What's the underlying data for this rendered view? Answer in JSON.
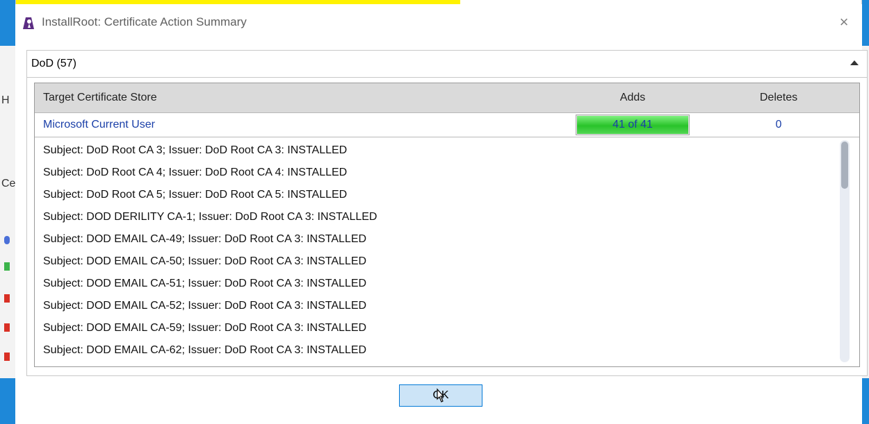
{
  "window": {
    "title": "InstallRoot: Certificate Action Summary",
    "close_glyph": "×"
  },
  "group": {
    "title": "DoD (57)"
  },
  "table": {
    "headers": {
      "store": "Target Certificate Store",
      "adds": "Adds",
      "deletes": "Deletes"
    },
    "store_row": {
      "name": "Microsoft Current User",
      "adds_text": "41 of 41",
      "adds_progress": 1.0,
      "deletes": "0"
    },
    "entries": [
      "Subject: DoD Root CA 3; Issuer: DoD Root CA 3: INSTALLED",
      "Subject: DoD Root CA 4; Issuer: DoD Root CA 4: INSTALLED",
      "Subject: DoD Root CA 5; Issuer: DoD Root CA 5: INSTALLED",
      "Subject: DOD DERILITY CA-1; Issuer: DoD Root CA 3: INSTALLED",
      "Subject: DOD EMAIL CA-49; Issuer: DoD Root CA 3: INSTALLED",
      "Subject: DOD EMAIL CA-50; Issuer: DoD Root CA 3: INSTALLED",
      "Subject: DOD EMAIL CA-51; Issuer: DoD Root CA 3: INSTALLED",
      "Subject: DOD EMAIL CA-52; Issuer: DoD Root CA 3: INSTALLED",
      "Subject: DOD EMAIL CA-59; Issuer: DoD Root CA 3: INSTALLED",
      "Subject: DOD EMAIL CA-62; Issuer: DoD Root CA 3: INSTALLED"
    ]
  },
  "footer": {
    "ok_label": "OK"
  },
  "background_fragments": [
    "H",
    "Ce"
  ],
  "colors": {
    "link_blue": "#1a3fa8",
    "progress_green": "#29c32a",
    "ok_button_bg": "#cce4f7",
    "ok_button_border": "#0078d7",
    "accent_blue": "#1e88d8"
  },
  "icons": {
    "app": "installroot-app-icon",
    "close": "close-icon",
    "collapse": "chevron-up-icon",
    "cursor": "mouse-pointer-icon"
  }
}
